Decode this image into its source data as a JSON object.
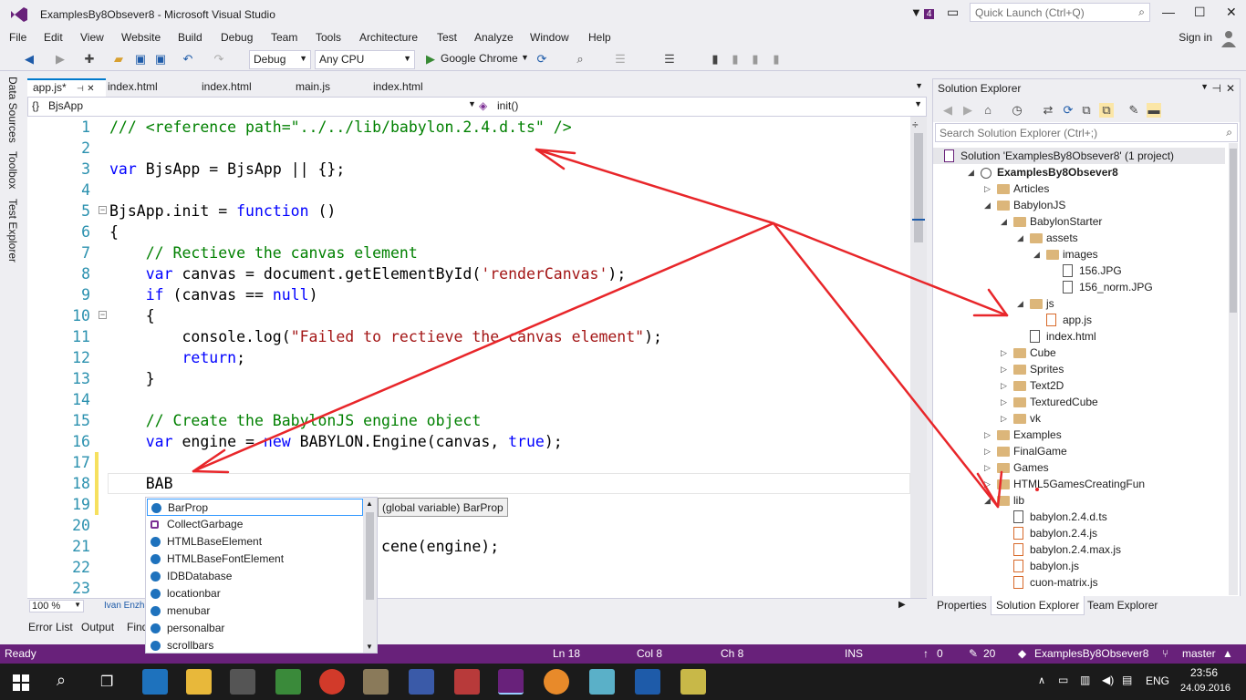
{
  "window": {
    "title": "ExamplesBy8Obsever8 - Microsoft Visual Studio",
    "notification_count": "4",
    "quick_launch_placeholder": "Quick Launch (Ctrl+Q)"
  },
  "menu": {
    "items": [
      "File",
      "Edit",
      "View",
      "Website",
      "Build",
      "Debug",
      "Team",
      "Tools",
      "Architecture",
      "Test",
      "Analyze",
      "Window",
      "Help"
    ],
    "sign_in": "Sign in"
  },
  "toolbar": {
    "configuration": "Debug",
    "platform": "Any CPU",
    "browser": "Google Chrome"
  },
  "left_dock": {
    "tabs": [
      "Data Sources",
      "Toolbox",
      "Test Explorer"
    ]
  },
  "doc_tabs": [
    "app.js*",
    "index.html",
    "index.html",
    "main.js",
    "index.html"
  ],
  "navigation": {
    "left": "BjsApp",
    "right": "init()"
  },
  "code_lines": [
    {
      "n": "1",
      "parts": [
        {
          "c": "cm",
          "t": "/// <reference path=\"../../lib/babylon.2.4.d.ts\" />"
        }
      ]
    },
    {
      "n": "2",
      "parts": []
    },
    {
      "n": "3",
      "parts": [
        {
          "c": "kw",
          "t": "var"
        },
        {
          "c": "pl",
          "t": " BjsApp = BjsApp || {};"
        }
      ]
    },
    {
      "n": "4",
      "parts": []
    },
    {
      "n": "5",
      "parts": [
        {
          "c": "pl",
          "t": "BjsApp.init = "
        },
        {
          "c": "kw",
          "t": "function"
        },
        {
          "c": "pl",
          "t": " ()"
        }
      ]
    },
    {
      "n": "6",
      "parts": [
        {
          "c": "pl",
          "t": "{"
        }
      ]
    },
    {
      "n": "7",
      "parts": [
        {
          "c": "cm",
          "t": "    // Rectieve the canvas element"
        }
      ]
    },
    {
      "n": "8",
      "parts": [
        {
          "c": "kw",
          "t": "    var"
        },
        {
          "c": "pl",
          "t": " canvas = document.getElementById("
        },
        {
          "c": "str",
          "t": "'renderCanvas'"
        },
        {
          "c": "pl",
          "t": ");"
        }
      ]
    },
    {
      "n": "9",
      "parts": [
        {
          "c": "kw",
          "t": "    if"
        },
        {
          "c": "pl",
          "t": " (canvas == "
        },
        {
          "c": "kw",
          "t": "null"
        },
        {
          "c": "pl",
          "t": ")"
        }
      ]
    },
    {
      "n": "10",
      "parts": [
        {
          "c": "pl",
          "t": "    {"
        }
      ]
    },
    {
      "n": "11",
      "parts": [
        {
          "c": "pl",
          "t": "        console.log("
        },
        {
          "c": "str",
          "t": "\"Failed to rectieve the canvas element\""
        },
        {
          "c": "pl",
          "t": ");"
        }
      ]
    },
    {
      "n": "12",
      "parts": [
        {
          "c": "kw",
          "t": "        return"
        },
        {
          "c": "pl",
          "t": ";"
        }
      ]
    },
    {
      "n": "13",
      "parts": [
        {
          "c": "pl",
          "t": "    }"
        }
      ]
    },
    {
      "n": "14",
      "parts": []
    },
    {
      "n": "15",
      "parts": [
        {
          "c": "cm",
          "t": "    // Create the BabylonJS engine object"
        }
      ]
    },
    {
      "n": "16",
      "parts": [
        {
          "c": "kw",
          "t": "    var"
        },
        {
          "c": "pl",
          "t": " engine = "
        },
        {
          "c": "kw",
          "t": "new"
        },
        {
          "c": "pl",
          "t": " BABYLON.Engine(canvas, "
        },
        {
          "c": "kw",
          "t": "true"
        },
        {
          "c": "pl",
          "t": ");"
        }
      ]
    },
    {
      "n": "17",
      "parts": []
    },
    {
      "n": "18",
      "parts": [
        {
          "c": "pl",
          "t": "    BAB"
        }
      ]
    },
    {
      "n": "19",
      "parts": []
    },
    {
      "n": "20",
      "parts": []
    },
    {
      "n": "21",
      "parts": [
        {
          "c": "pl",
          "t": "                              cene(engine);"
        }
      ]
    },
    {
      "n": "22",
      "parts": []
    },
    {
      "n": "23",
      "parts": []
    }
  ],
  "intellisense": {
    "items": [
      "BarProp",
      "CollectGarbage",
      "HTMLBaseElement",
      "HTMLBaseFontElement",
      "IDBDatabase",
      "locationbar",
      "menubar",
      "personalbar",
      "scrollbars"
    ],
    "tooltip": "(global variable) BarProp"
  },
  "editor_footer": {
    "zoom": "100 %",
    "author": "Ivan Enzha"
  },
  "bottom_tabs": [
    "Error List",
    "Output",
    "Find"
  ],
  "solution_explorer": {
    "title": "Solution Explorer",
    "search_placeholder": "Search Solution Explorer (Ctrl+;)",
    "tree": [
      {
        "label": "Solution 'ExamplesBy8Obsever8' (1 project)",
        "type": "solution",
        "indent": 0
      },
      {
        "label": "ExamplesBy8Obsever8",
        "type": "project",
        "indent": 1,
        "expanded": true
      },
      {
        "label": "Articles",
        "type": "folder",
        "indent": 2,
        "expanded": false
      },
      {
        "label": "BabylonJS",
        "type": "folder",
        "indent": 2,
        "expanded": true
      },
      {
        "label": "BabylonStarter",
        "type": "folder",
        "indent": 3,
        "expanded": true
      },
      {
        "label": "assets",
        "type": "folder",
        "indent": 4,
        "expanded": true
      },
      {
        "label": "images",
        "type": "folder",
        "indent": 5,
        "expanded": true
      },
      {
        "label": "156.JPG",
        "type": "image",
        "indent": 6
      },
      {
        "label": "156_norm.JPG",
        "type": "image",
        "indent": 6
      },
      {
        "label": "js",
        "type": "folder",
        "indent": 4,
        "expanded": true
      },
      {
        "label": "app.js",
        "type": "js",
        "indent": 5
      },
      {
        "label": "index.html",
        "type": "file",
        "indent": 4
      },
      {
        "label": "Cube",
        "type": "folder",
        "indent": 3,
        "expanded": false
      },
      {
        "label": "Sprites",
        "type": "folder",
        "indent": 3,
        "expanded": false
      },
      {
        "label": "Text2D",
        "type": "folder",
        "indent": 3,
        "expanded": false
      },
      {
        "label": "TexturedCube",
        "type": "folder",
        "indent": 3,
        "expanded": false
      },
      {
        "label": "vk",
        "type": "folder",
        "indent": 3,
        "expanded": false
      },
      {
        "label": "Examples",
        "type": "folder",
        "indent": 2,
        "expanded": false
      },
      {
        "label": "FinalGame",
        "type": "folder",
        "indent": 2,
        "expanded": false
      },
      {
        "label": "Games",
        "type": "folder",
        "indent": 2,
        "expanded": false
      },
      {
        "label": "HTML5GamesCreatingFun",
        "type": "folder",
        "indent": 2,
        "expanded": false
      },
      {
        "label": "lib",
        "type": "folder",
        "indent": 2,
        "expanded": true
      },
      {
        "label": "babylon.2.4.d.ts",
        "type": "file",
        "indent": 3
      },
      {
        "label": "babylon.2.4.js",
        "type": "js",
        "indent": 3
      },
      {
        "label": "babylon.2.4.max.js",
        "type": "js",
        "indent": 3
      },
      {
        "label": "babylon.js",
        "type": "js",
        "indent": 3
      },
      {
        "label": "cuon-matrix.js",
        "type": "js",
        "indent": 3
      }
    ],
    "bottom_tabs": [
      "Properties",
      "Solution Explorer",
      "Team Explorer"
    ]
  },
  "status_bar": {
    "state": "Ready",
    "line": "Ln 18",
    "col": "Col 8",
    "ch": "Ch 8",
    "mode": "INS",
    "up": "0",
    "changes": "20",
    "repo": "ExamplesBy8Obsever8",
    "branch": "master"
  },
  "taskbar": {
    "time": "23:56",
    "date": "24.09.2016",
    "lang": "ENG"
  },
  "colors": {
    "accent": "#68217a",
    "keyword": "#0000ff",
    "comment": "#008000",
    "string": "#a31515",
    "annotation_arrows": "#e8262a"
  }
}
